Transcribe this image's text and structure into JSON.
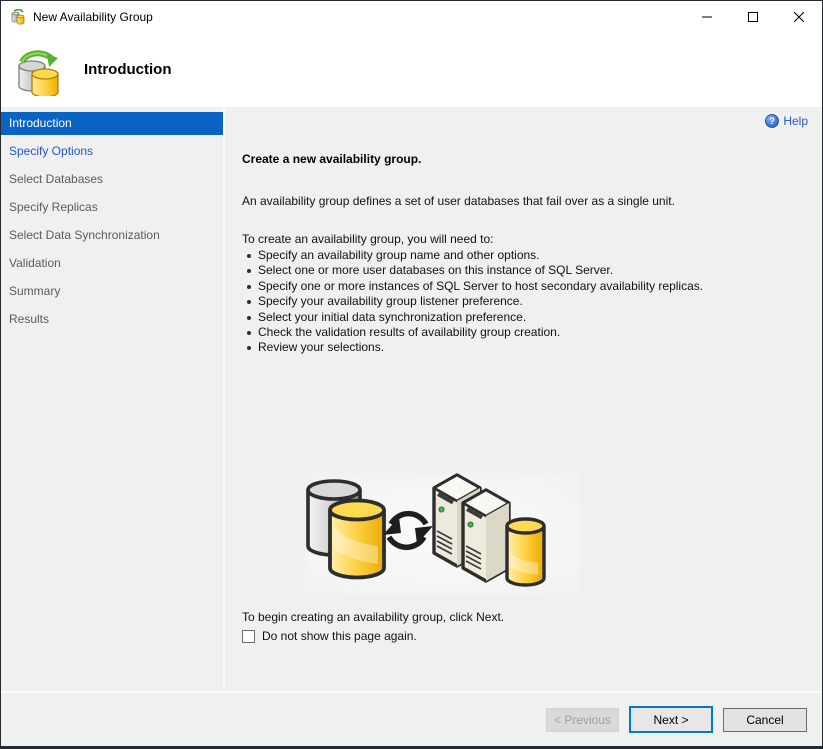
{
  "window": {
    "title": "New Availability Group",
    "app_icon": "database-cylinders-sync-icon",
    "controls": {
      "minimize": "minimize-icon",
      "maximize": "maximize-icon",
      "close": "close-icon"
    }
  },
  "header": {
    "title": "Introduction",
    "icon": "database-replication-icon"
  },
  "sidebar": {
    "items": [
      {
        "label": "Introduction",
        "state": "active"
      },
      {
        "label": "Specify Options",
        "state": "link"
      },
      {
        "label": "Select Databases",
        "state": "normal"
      },
      {
        "label": "Specify Replicas",
        "state": "normal"
      },
      {
        "label": "Select Data Synchronization",
        "state": "normal"
      },
      {
        "label": "Validation",
        "state": "normal"
      },
      {
        "label": "Summary",
        "state": "normal"
      },
      {
        "label": "Results",
        "state": "normal"
      }
    ]
  },
  "content": {
    "help_label": "Help",
    "help_icon": "question-mark-circle-icon",
    "heading": "Create a new availability group.",
    "intro": "An availability group defines a set of user databases that fail over as a single unit.",
    "list_intro": "To create an availability group, you will need to:",
    "bullets": [
      "Specify an availability group name and other options.",
      "Select one or more user databases on this instance of SQL Server.",
      "Specify one or more instances of SQL Server to host secondary availability replicas.",
      "Specify your availability group listener preference.",
      "Select your initial data synchronization preference.",
      "Check the validation results of availability group creation.",
      "Review your selections."
    ],
    "graphic": "databases-sync-to-servers-illustration",
    "footer_text": "To begin creating an availability group, click Next.",
    "checkbox_label": "Do not show this page again.",
    "checkbox_checked": false
  },
  "buttons": {
    "previous": {
      "label": "< Previous",
      "enabled": false
    },
    "next": {
      "label": "Next >",
      "enabled": true,
      "default": true
    },
    "cancel": {
      "label": "Cancel",
      "enabled": true
    }
  },
  "colors": {
    "selected_step_bg": "#0b64c4",
    "link_blue": "#2456c5",
    "body_bg": "#f0f0f0",
    "default_button_border": "#0078d7"
  }
}
